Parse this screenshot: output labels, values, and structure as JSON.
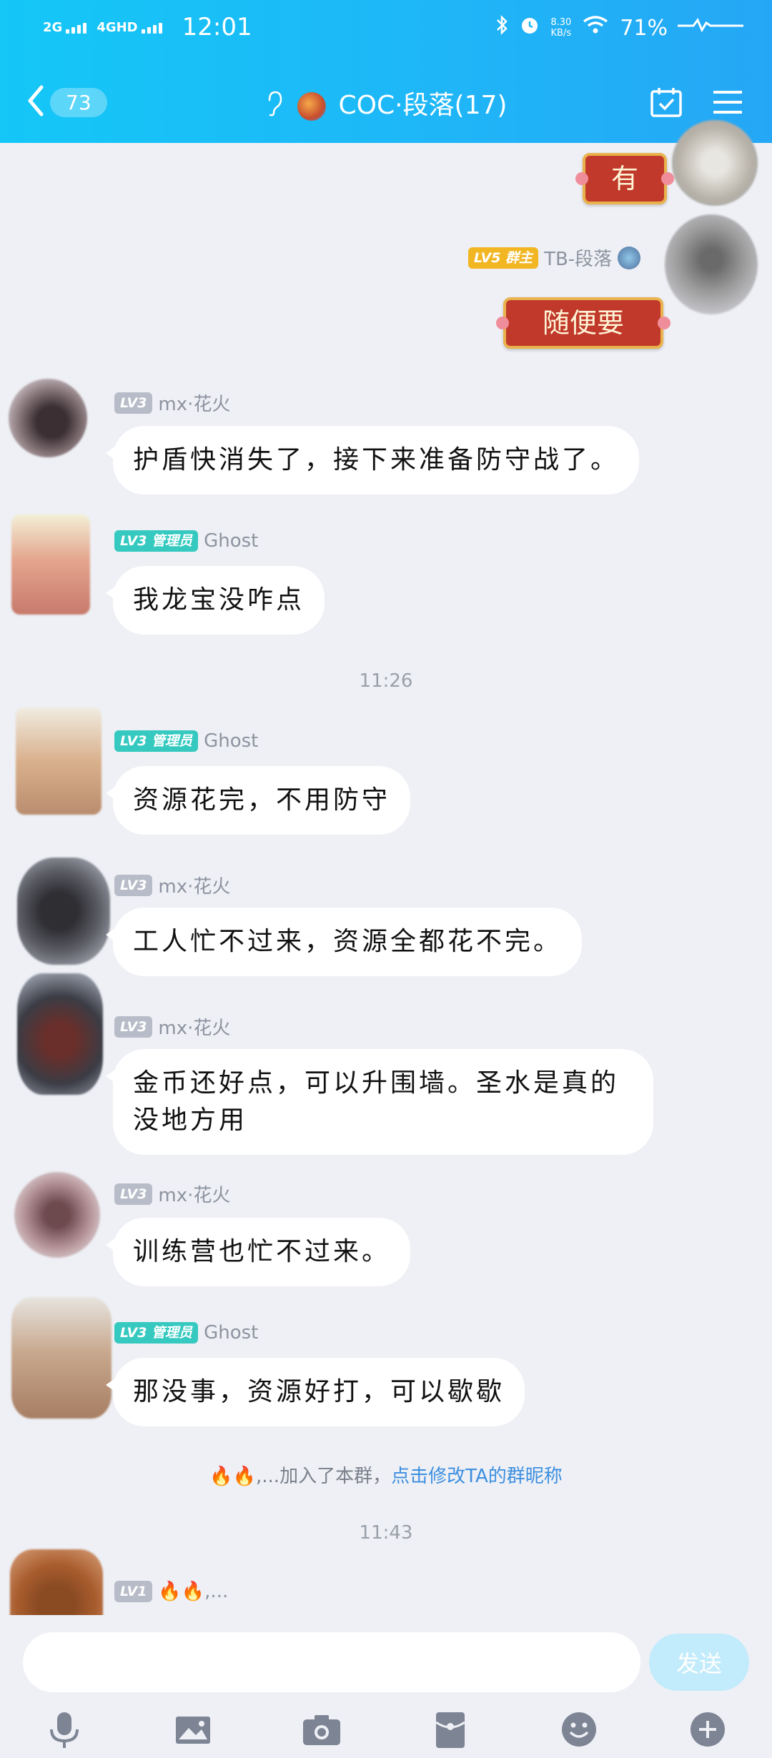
{
  "status_bar": {
    "network1": "2G",
    "network2": "4GHD",
    "time": "12:01",
    "speed_value": "8.30",
    "speed_unit": "KB/s",
    "battery": "71%"
  },
  "header": {
    "back_count": "73",
    "title": "COC·段落(17)"
  },
  "messages": [
    {
      "sticker": "有"
    },
    {
      "level": "LV5",
      "role": "群主",
      "name": "TB-段落",
      "sticker": "随便要"
    },
    {
      "level": "LV3",
      "name": "mx·花火",
      "text": "护盾快消失了，接下来准备防守战了。"
    },
    {
      "level": "LV3",
      "role": "管理员",
      "name": "Ghost",
      "text": "我龙宝没咋点"
    },
    {
      "level": "LV3",
      "role": "管理员",
      "name": "Ghost",
      "text": "资源花完，不用防守"
    },
    {
      "level": "LV3",
      "name": "mx·花火",
      "text": "工人忙不过来，资源全都花不完。"
    },
    {
      "level": "LV3",
      "name": "mx·花火",
      "text": "金币还好点，可以升围墙。圣水是真的没地方用"
    },
    {
      "level": "LV3",
      "name": "mx·花火",
      "text": "训练营也忙不过来。"
    },
    {
      "level": "LV3",
      "role": "管理员",
      "name": "Ghost",
      "text": "那没事，资源好打，可以歇歇"
    },
    {
      "level": "LV1",
      "name": "🔥🔥,..."
    }
  ],
  "time_separators": [
    "11:26",
    "11:43"
  ],
  "system": {
    "joined_name": "🔥🔥,...",
    "joined_text": "加入了本群，",
    "link_text": "点击修改TA的群昵称"
  },
  "input": {
    "value": "",
    "send_label": "发送"
  },
  "colors": {
    "header_start": "#14c7f7",
    "header_end": "#25a7f5",
    "chat_bg": "#eef0f5",
    "admin_badge": "#35c9c0",
    "owner_badge": "#f2b623",
    "level_badge": "#b7bcc8",
    "link": "#3d8fe0"
  },
  "toolbar_icons": [
    "microphone-icon",
    "image-icon",
    "camera-icon",
    "red-packet-icon",
    "emoji-icon",
    "plus-icon"
  ]
}
